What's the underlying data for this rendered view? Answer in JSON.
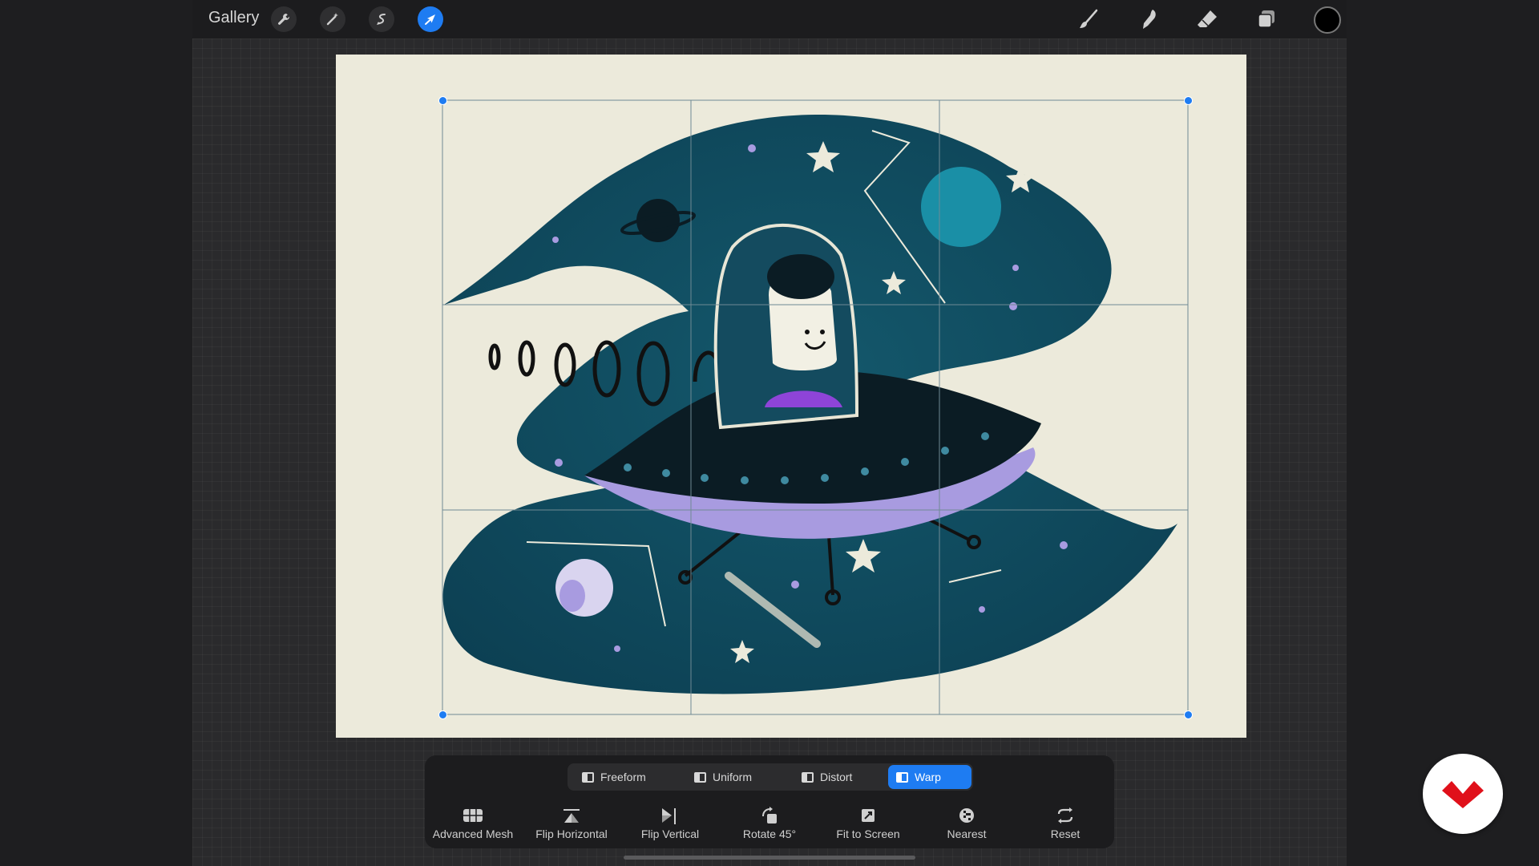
{
  "topbar": {
    "gallery_label": "Gallery",
    "left_tools": [
      "wrench-icon",
      "magic-wand-icon",
      "selection-icon",
      "transform-arrow-icon"
    ],
    "active_tool": "transform-arrow-icon",
    "right_tools": [
      "brush-icon",
      "smudge-icon",
      "eraser-icon",
      "layers-icon"
    ],
    "current_color": "#000000"
  },
  "transform": {
    "modes": [
      {
        "label": "Freeform",
        "active": false
      },
      {
        "label": "Uniform",
        "active": false
      },
      {
        "label": "Distort",
        "active": false
      },
      {
        "label": "Warp",
        "active": true
      }
    ],
    "actions": [
      {
        "label": "Advanced Mesh",
        "icon": "mesh-icon"
      },
      {
        "label": "Flip Horizontal",
        "icon": "flip-horizontal-icon"
      },
      {
        "label": "Flip Vertical",
        "icon": "flip-vertical-icon"
      },
      {
        "label": "Rotate 45°",
        "icon": "rotate-icon"
      },
      {
        "label": "Fit to Screen",
        "icon": "fit-screen-icon"
      },
      {
        "label": "Nearest",
        "icon": "nearest-icon"
      },
      {
        "label": "Reset",
        "icon": "reset-icon"
      }
    ]
  },
  "colors": {
    "accent": "#1e7cf2",
    "canvas_bg": "#eceadb",
    "space": "#0f4a5e",
    "saucer_purple": "#a89be0",
    "logo_red": "#e0101a"
  }
}
